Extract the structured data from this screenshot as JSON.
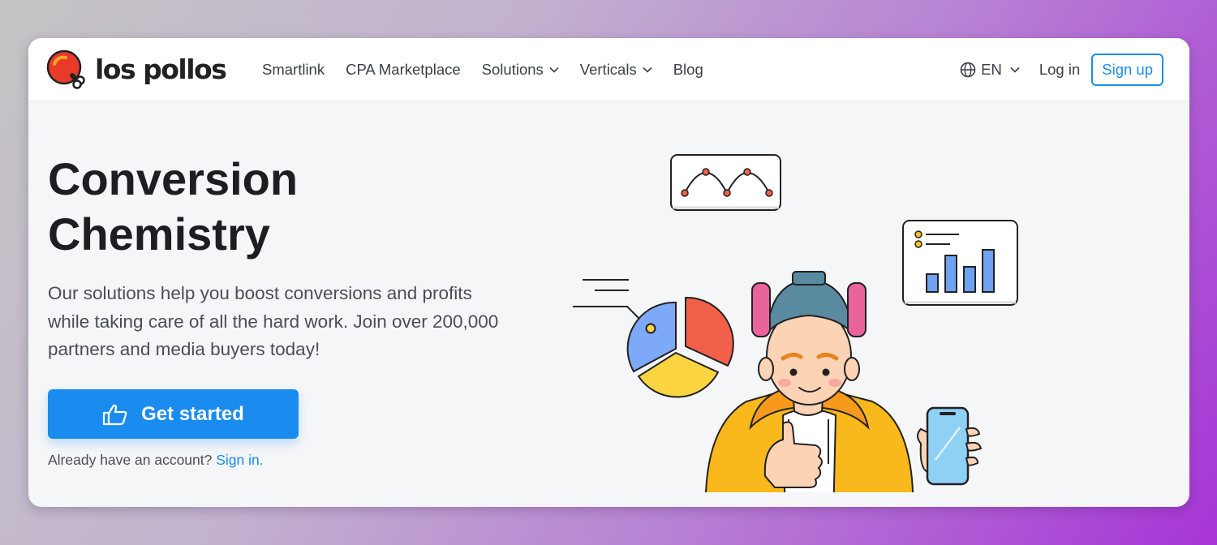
{
  "brand": {
    "name": "los pollos",
    "logo_colors": [
      "#e8392b",
      "#f6a623"
    ]
  },
  "nav": {
    "items": [
      {
        "label": "Smartlink",
        "dropdown": false
      },
      {
        "label": "CPA Marketplace",
        "dropdown": false
      },
      {
        "label": "Solutions",
        "dropdown": true
      },
      {
        "label": "Verticals",
        "dropdown": true
      },
      {
        "label": "Blog",
        "dropdown": false
      }
    ],
    "language": "EN",
    "login": "Log in",
    "signup": "Sign up"
  },
  "hero": {
    "title_line1": "Conversion",
    "title_line2": "Chemistry",
    "description": "Our solutions help you boost conversions and profits while taking care of all the hard work. Join over 200,000 partners and media buyers today!",
    "cta_label": "Get started",
    "account_prompt": "Already have an account?",
    "signin_link": "Sign in."
  },
  "colors": {
    "accent": "#1a8cf0",
    "hoodie": "#f9b81b",
    "headphones": "#e8649a",
    "pie": [
      "#f2604a",
      "#fbd441",
      "#7ea8f8"
    ],
    "bars": "#6fa2f0"
  },
  "icons": [
    "globe-icon",
    "chevron-down-icon",
    "thumbs-up-icon"
  ]
}
